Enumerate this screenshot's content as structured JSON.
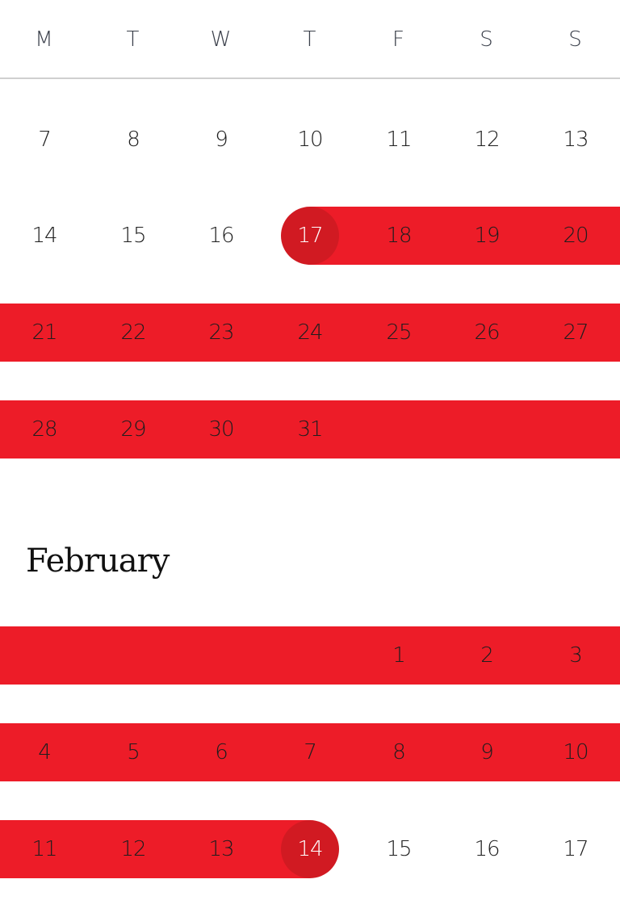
{
  "weekdays": [
    "M",
    "T",
    "W",
    "T",
    "F",
    "S",
    "S"
  ],
  "january_rows": [
    [
      "7",
      "8",
      "9",
      "10",
      "11",
      "12",
      "13"
    ],
    [
      "14",
      "15",
      "16",
      "17",
      "18",
      "19",
      "20"
    ],
    [
      "21",
      "22",
      "23",
      "24",
      "25",
      "26",
      "27"
    ],
    [
      "28",
      "29",
      "30",
      "31",
      "",
      "",
      ""
    ]
  ],
  "february": {
    "title": "February",
    "rows": [
      [
        "",
        "",
        "",
        "",
        "1",
        "2",
        "3"
      ],
      [
        "4",
        "5",
        "6",
        "7",
        "8",
        "9",
        "10"
      ],
      [
        "11",
        "12",
        "13",
        "14",
        "15",
        "16",
        "17"
      ]
    ]
  },
  "selection": {
    "start_label": "17",
    "end_label": "14",
    "band_color": "#ed1c28",
    "endpoint_color": "#d11a22"
  }
}
